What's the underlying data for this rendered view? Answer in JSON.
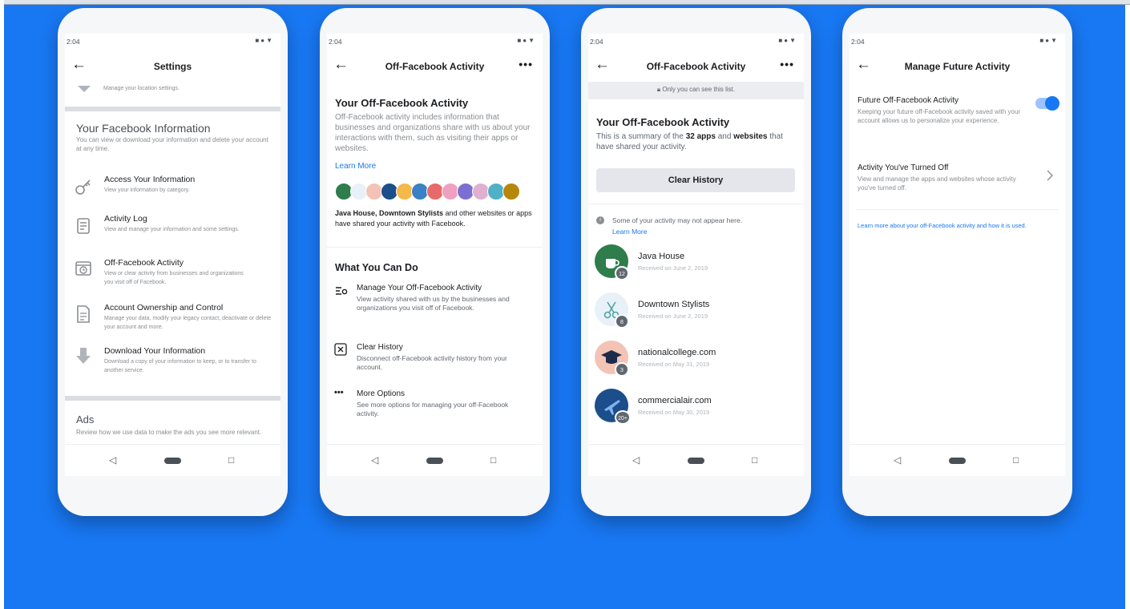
{
  "colors": {
    "background": "#1877f2",
    "accent": "#1877f2",
    "text": "#1c1e21",
    "muted": "#8a8d91"
  },
  "nav": {
    "back_icon": "arrow-left-icon",
    "more_icon": "more-horizontal-icon",
    "back_nav": "◁",
    "recents_nav": "□"
  },
  "phone1": {
    "time": "2:04",
    "title": "Settings",
    "location_text": "Manage your location settings.",
    "section_title": "Your Facebook Information",
    "section_desc": "You can view or download your information and delete your account at any time.",
    "items": [
      {
        "icon": "key-icon",
        "title": "Access Your Information",
        "desc": "View your information by category."
      },
      {
        "icon": "list-icon",
        "title": "Activity Log",
        "desc": "View and manage your information and some settings."
      },
      {
        "icon": "history-icon",
        "title": "Off-Facebook Activity",
        "desc": "View or clear activity from businesses and organizations you visit off of Facebook."
      },
      {
        "icon": "document-icon",
        "title": "Account Ownership and Control",
        "desc": "Manage your data, modify your legacy contact, deactivate or delete your account and more."
      },
      {
        "icon": "download-icon",
        "title": "Download Your Information",
        "desc": "Download a copy of your information to keep, or to transfer to another service."
      }
    ],
    "ads_title": "Ads",
    "ads_desc": "Review how we use data to make the ads you see more relevant."
  },
  "phone2": {
    "time": "2:04",
    "title": "Off-Facebook Activity",
    "heading": "Your Off-Facebook Activity",
    "intro": "Off-Facebook activity includes information that businesses and organizations share with us about your interactions with them, such as visiting their apps or websites.",
    "learn_more": "Learn More",
    "shared_names": "Java House, Downtown Stylists",
    "shared_rest": " and other websites or apps have shared your activity with Facebook.",
    "what_title": "What You Can Do",
    "actions": [
      {
        "icon": "manage-icon",
        "title": "Manage Your Off-Facebook Activity",
        "desc": "View activity shared with us by the businesses and organizations you visit off of Facebook."
      },
      {
        "icon": "clear-icon",
        "title": "Clear History",
        "desc": "Disconnect off-Facebook activity history from your account."
      },
      {
        "icon": "more-icon",
        "title": "More Options",
        "desc": "See more options for managing your off-Facebook activity."
      }
    ]
  },
  "phone3": {
    "time": "2:04",
    "title": "Off-Facebook Activity",
    "private_note": "Only you can see this list.",
    "heading": "Your Off-Facebook Activity",
    "summary_a": "This is a summary of the ",
    "summary_b": "32 apps",
    "summary_c": " and ",
    "summary_d": "websites",
    "summary_e": " that have shared your activity.",
    "clear_button": "Clear History",
    "notice": "Some of your activity may not appear here.",
    "learn_more": "Learn More",
    "apps": [
      {
        "name": "Java House",
        "date": "Received on June 2, 2019",
        "count": "12",
        "color": "#2e7d4a",
        "icon": "coffee-icon"
      },
      {
        "name": "Downtown Stylists",
        "date": "Received on June 2, 2019",
        "count": "8",
        "color": "#e8f1f8",
        "icon": "scissors-icon"
      },
      {
        "name": "nationalcollege.com",
        "date": "Received on May 31, 2019",
        "count": "3",
        "color": "#f3c3b5",
        "icon": "graduation-cap-icon"
      },
      {
        "name": "commercialair.com",
        "date": "Received on May 30, 2019",
        "count": "20+",
        "color": "#1b4e8a",
        "icon": "airplane-icon"
      }
    ]
  },
  "phone4": {
    "time": "2:04",
    "title": "Manage Future Activity",
    "future_title": "Future Off-Facebook Activity",
    "future_desc": "Keeping your future off-Facebook activity saved with your account allows us to personalize your experience.",
    "toggle_on": true,
    "turned_off_title": "Activity You've Turned Off",
    "turned_off_desc": "View and manage the apps and websites whose activity you've turned off.",
    "learn_link": "Learn more about your off-Facebook activity and how it is used."
  }
}
